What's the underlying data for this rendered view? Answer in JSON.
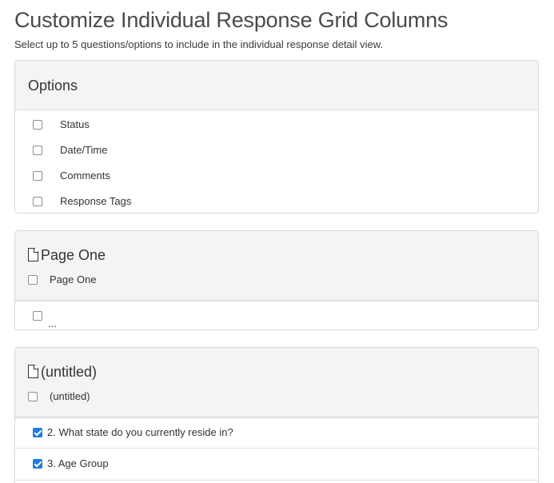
{
  "header": {
    "title": "Customize Individual Response Grid Columns",
    "subtitle": "Select up to 5 questions/options to include in the individual response detail view."
  },
  "options_panel": {
    "title": "Options",
    "items": [
      {
        "label": "Status",
        "checked": false
      },
      {
        "label": "Date/Time",
        "checked": false
      },
      {
        "label": "Comments",
        "checked": false
      },
      {
        "label": "Response Tags",
        "checked": false
      }
    ]
  },
  "page_one_panel": {
    "heading": "Page One",
    "page_option": {
      "label": "Page One",
      "checked": false
    },
    "questions": [
      {
        "label": "...",
        "checked": false
      }
    ]
  },
  "untitled_panel": {
    "heading": "(untitled)",
    "page_option": {
      "label": "(untitled)",
      "checked": false
    },
    "questions": [
      {
        "label": "2. What state do you currently reside in?",
        "checked": true
      },
      {
        "label": "3. Age Group",
        "checked": true
      }
    ]
  },
  "icons": {
    "page": "document-icon",
    "checkbox_checked_color": "#1e7ce3"
  }
}
